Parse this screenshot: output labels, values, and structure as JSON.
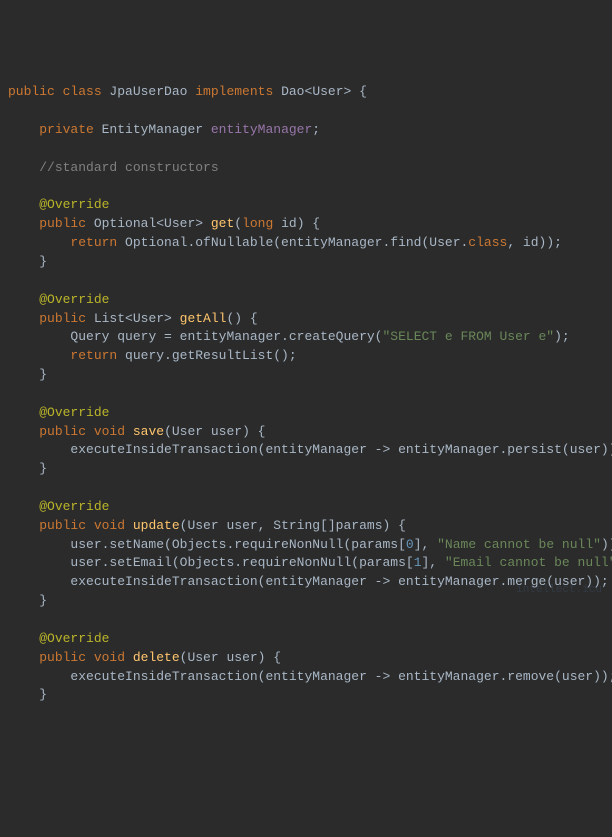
{
  "code": {
    "line1": {
      "kw1": "public class",
      "cls": " JpaUserDao",
      "kw2": " implements",
      "iface": " Dao",
      "lt": "<",
      "gen": "User",
      "gt": ">",
      "brace": " {"
    },
    "blank1": " ",
    "line2": {
      "indent": "    ",
      "kw": "private",
      "type": " EntityManager ",
      "field": "entityManager",
      "semi": ";"
    },
    "blank2": " ",
    "line3": {
      "indent": "    ",
      "comment": "//standard constructors"
    },
    "blank3": " ",
    "line4": {
      "indent": "    ",
      "ann": "@Override"
    },
    "line5": {
      "indent": "    ",
      "kw": "public",
      "type": " Optional<User> ",
      "method": "get",
      "paren1": "(",
      "kw2": "long",
      "param": " id) {"
    },
    "line6": {
      "indent": "        ",
      "kw": "return",
      "rest": " Optional.ofNullable(entityManager.find(User.",
      "kw2": "class",
      "rest2": ", id));"
    },
    "line7": {
      "indent": "    ",
      "brace": "}"
    },
    "blank4": " ",
    "line8": {
      "indent": "    ",
      "ann": "@Override"
    },
    "line9": {
      "indent": "    ",
      "kw": "public",
      "type": " List<User> ",
      "method": "getAll",
      "rest": "() {"
    },
    "line10": {
      "indent": "        ",
      "type": "Query ",
      "var": "query = entityManager.createQuery(",
      "str": "\"SELECT e FROM User e\"",
      "rest": ");"
    },
    "line11": {
      "indent": "        ",
      "kw": "return",
      "rest": " query.getResultList();"
    },
    "line12": {
      "indent": "    ",
      "brace": "}"
    },
    "blank5": " ",
    "line13": {
      "indent": "    ",
      "ann": "@Override"
    },
    "line14": {
      "indent": "    ",
      "kw": "public void",
      "method": " save",
      "rest": "(User user) {"
    },
    "line15": {
      "indent": "        ",
      "rest": "executeInsideTransaction(entityManager -> entityManager.persist(user));"
    },
    "line16": {
      "indent": "    ",
      "brace": "}"
    },
    "blank6": " ",
    "line17": {
      "indent": "    ",
      "ann": "@Override"
    },
    "line18": {
      "indent": "    ",
      "kw": "public void",
      "method": " update",
      "rest": "(User user, String[]params) {"
    },
    "line19": {
      "indent": "        ",
      "rest1": "user.setName(Objects.requireNonNull(params[",
      "num": "0",
      "rest2": "], ",
      "str": "\"Name cannot be null\"",
      "rest3": "));"
    },
    "line20": {
      "indent": "        ",
      "rest1": "user.setEmail(Objects.requireNonNull(params[",
      "num": "1",
      "rest2": "], ",
      "str": "\"Email cannot be null\"",
      "rest3": "));"
    },
    "line21": {
      "indent": "        ",
      "rest": "executeInsideTransaction(entityManager -> entityManager.merge(user));"
    },
    "line22": {
      "indent": "    ",
      "brace": "}"
    },
    "blank7": " ",
    "line23": {
      "indent": "    ",
      "ann": "@Override"
    },
    "line24": {
      "indent": "    ",
      "kw": "public void",
      "method": " delete",
      "rest": "(User user) {"
    },
    "line25": {
      "indent": "        ",
      "rest": "executeInsideTransaction(entityManager -> entityManager.remove(user));"
    },
    "line26": {
      "indent": "    ",
      "brace": "}"
    }
  },
  "watermark": "intellect.icu"
}
